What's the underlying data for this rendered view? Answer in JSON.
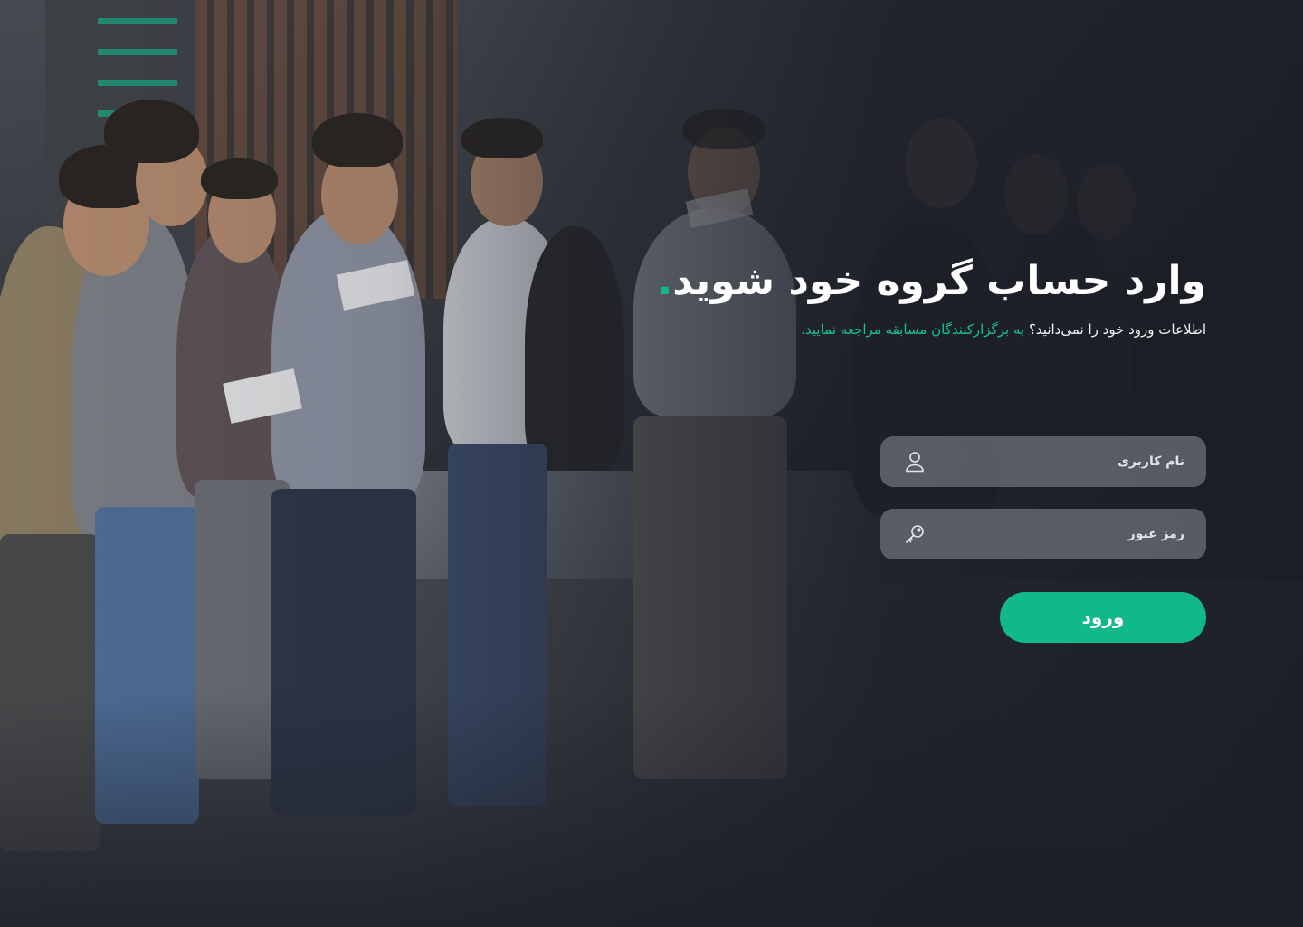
{
  "login": {
    "title": "وارد حساب گروه خود شوید",
    "title_dot": ".",
    "hint_prefix": "اطلاعات ورود خود را نمی‌دانید؟ ",
    "hint_link": "به برگزارکنندگان مسابقه مراجعه نمایید.",
    "username": {
      "placeholder": "نام کاربری",
      "value": "",
      "icon": "user-icon"
    },
    "password": {
      "placeholder": "رمز عبور",
      "value": "",
      "icon": "key-icon"
    },
    "submit_label": "ورود"
  },
  "colors": {
    "accent": "#10b88a",
    "background": "#1d2029",
    "field": "#6e707a",
    "text": "#ffffff"
  },
  "background_image": "people-standing-in-line-photo"
}
